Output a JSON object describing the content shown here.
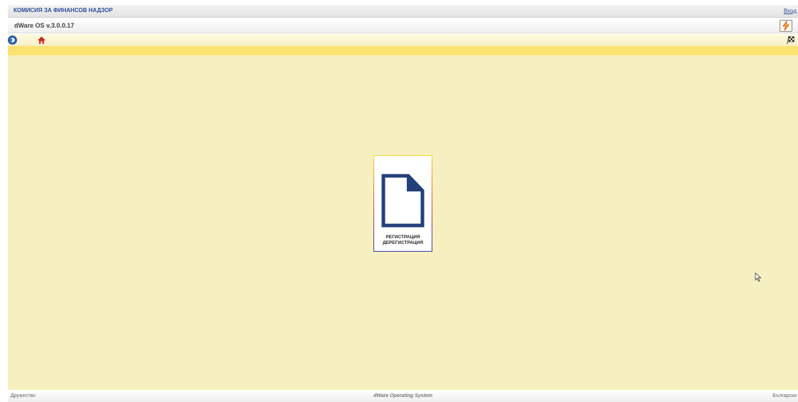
{
  "header": {
    "org_name": "КОМИСИЯ ЗА ФИНАНСОВ НАДЗОР",
    "login_label": "Вход",
    "version": "dWare OS v.3.0.0.17"
  },
  "toolbar": {
    "back_icon": "back-circle-icon",
    "home_icon": "home-icon",
    "finish_icon": "checkered-flag-icon",
    "app_icon": "lightning-app-icon"
  },
  "main": {
    "tile": {
      "icon": "document-icon",
      "label_line1": "РЕГИСТРАЦИЯ",
      "label_line2": "ДЕРЕГИСТРАЦИЯ"
    }
  },
  "footer": {
    "left": "Дружество",
    "center": "dWare Operating System",
    "right": "Български"
  },
  "colors": {
    "accent": "#2d4c9a",
    "stripe": "#fde271",
    "content_bg": "#f6f0c1",
    "document_fill": "#23407a"
  }
}
